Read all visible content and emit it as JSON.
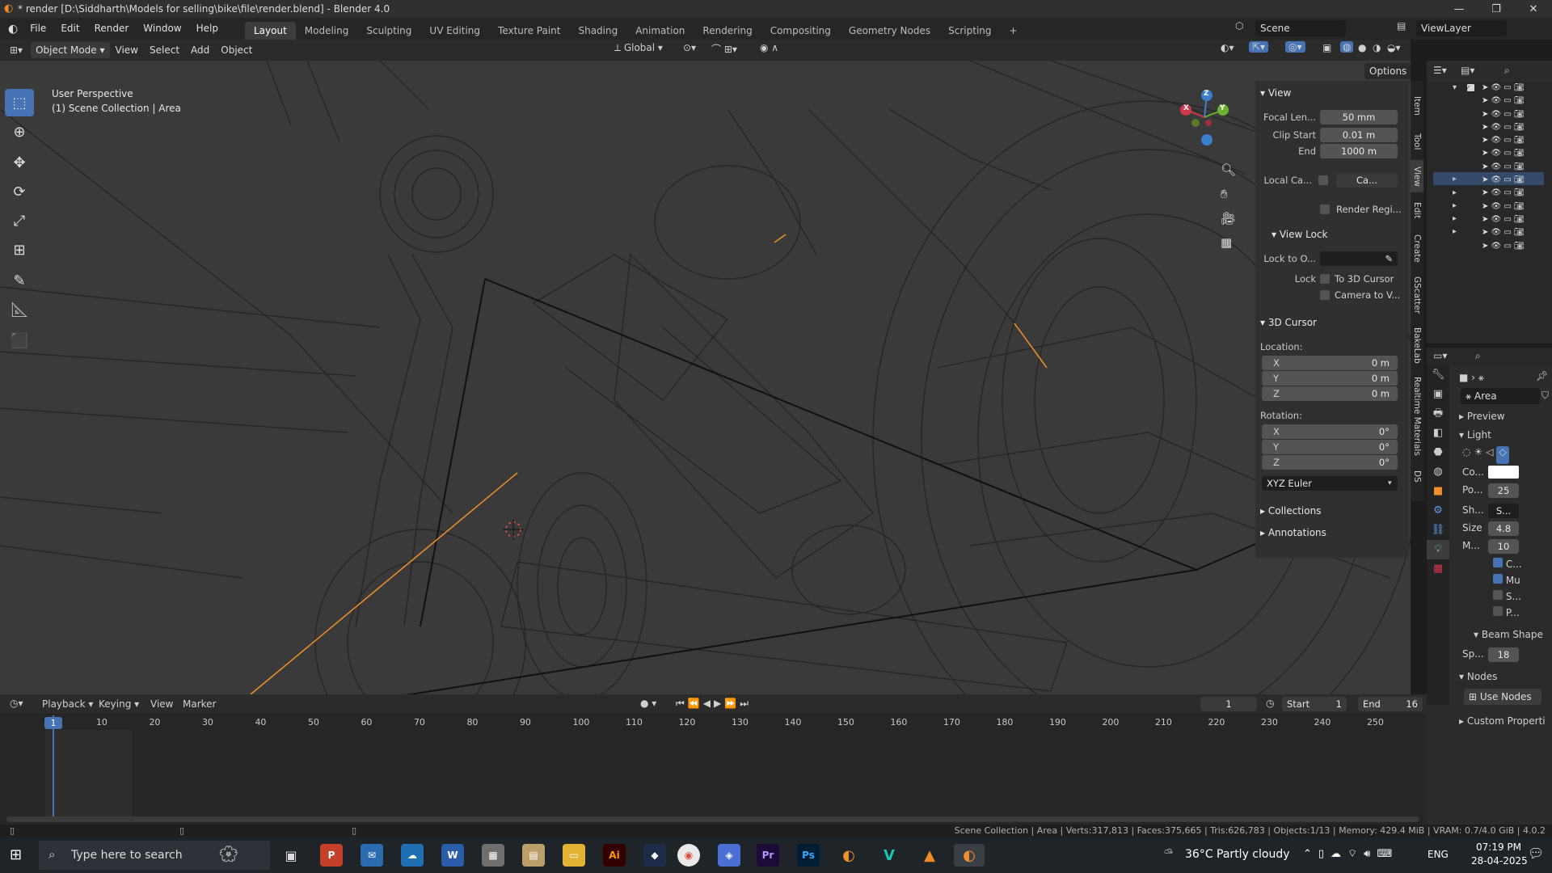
{
  "window": {
    "title": "* render [D:\\Siddharth\\Models for selling\\bike\\file\\render.blend] - Blender 4.0"
  },
  "menu": {
    "items": [
      "File",
      "Edit",
      "Render",
      "Window",
      "Help"
    ]
  },
  "workspaces": [
    "Layout",
    "Modeling",
    "Sculpting",
    "UV Editing",
    "Texture Paint",
    "Shading",
    "Animation",
    "Rendering",
    "Compositing",
    "Geometry Nodes",
    "Scripting"
  ],
  "scene": {
    "name": "Scene",
    "view_layer": "ViewLayer"
  },
  "viewport_header": {
    "mode": "Object Mode",
    "menus": [
      "View",
      "Select",
      "Add",
      "Object"
    ],
    "transform": "Global",
    "options": "Options"
  },
  "viewport_overlay": {
    "perspective": "User Perspective",
    "collection": "(1) Scene Collection | Area"
  },
  "gizmo": {
    "x": "X",
    "y": "Y",
    "z": "Z"
  },
  "npanel": {
    "view_header": "View",
    "focal_label": "Focal Len...",
    "focal_value": "50 mm",
    "clip_start_label": "Clip Start",
    "clip_start_value": "0.01 m",
    "end_label": "End",
    "end_value": "1000 m",
    "local_cam_label": "Local Ca...",
    "local_cam_value": "Ca...",
    "render_region": "Render Regi...",
    "view_lock_header": "View Lock",
    "lock_to_label": "Lock to O...",
    "lock_label": "Lock",
    "to_cursor": "To 3D Cursor",
    "camera_to_view": "Camera to V...",
    "cursor_header": "3D Cursor",
    "location_label": "Location:",
    "loc": [
      {
        "axis": "X",
        "value": "0 m"
      },
      {
        "axis": "Y",
        "value": "0 m"
      },
      {
        "axis": "Z",
        "value": "0 m"
      }
    ],
    "rotation_label": "Rotation:",
    "rot": [
      {
        "axis": "X",
        "value": "0°"
      },
      {
        "axis": "Y",
        "value": "0°"
      },
      {
        "axis": "Z",
        "value": "0°"
      }
    ],
    "rotation_mode": "XYZ Euler",
    "collections": "Collections",
    "annotations": "Annotations"
  },
  "sidebar_tabs": [
    "Item",
    "Tool",
    "View",
    "Edit",
    "Create",
    "GScatter",
    "BakeLab",
    "Realtime Materials",
    "DS"
  ],
  "properties": {
    "object_name": "Area",
    "preview": "Preview",
    "light": "Light",
    "color_label": "Co...",
    "power_label": "Po...",
    "power_value": "25",
    "shape_label": "Sh...",
    "shape_value": "S...",
    "size_label": "Size",
    "size_value": "4.8",
    "m_label": "M...",
    "m_value": "10",
    "c_label": "C...",
    "mu_label": "Mu",
    "s_label": "S...",
    "p_label": "P...",
    "beam_shape": "Beam Shape",
    "sp_label": "Sp...",
    "sp_value": "18",
    "nodes": "Nodes",
    "use_nodes": "Use Nodes",
    "custom_props": "Custom Properti"
  },
  "timeline": {
    "menus": [
      "Playback",
      "Keying",
      "View",
      "Marker"
    ],
    "current_frame": "1",
    "start_label": "Start",
    "start_value": "1",
    "end_label": "End",
    "end_value": "16",
    "ruler": [
      "1",
      "10",
      "20",
      "30",
      "40",
      "50",
      "60",
      "70",
      "80",
      "90",
      "100",
      "110",
      "120",
      "130",
      "140",
      "150",
      "160",
      "170",
      "180",
      "190",
      "200",
      "210",
      "220",
      "230",
      "240",
      "250"
    ]
  },
  "statusbar": {
    "text": "Scene Collection | Area | Verts:317,813 | Faces:375,665 | Tris:626,783 | Objects:1/13 | Memory: 429.4 MiB | VRAM: 0.7/4.0 GiB | 4.0.2"
  },
  "taskbar": {
    "search_placeholder": "Type here to search",
    "weather": "36°C  Partly cloudy",
    "lang": "ENG",
    "time": "07:19 PM",
    "date": "28-04-2025",
    "apps": [
      "P",
      "W",
      "Ai",
      "Pr",
      "Ps"
    ]
  },
  "colors": {
    "accent": "#4772b3",
    "orange": "#f0902a"
  }
}
